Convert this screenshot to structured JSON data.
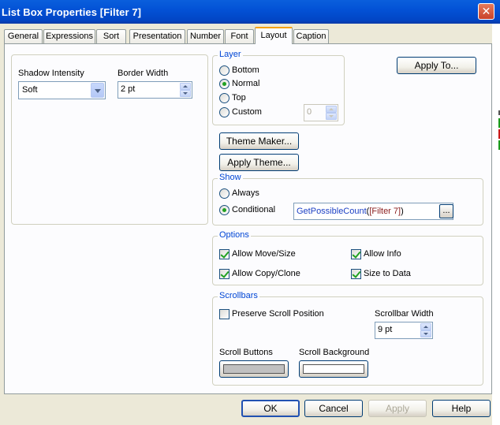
{
  "window": {
    "title": "List Box Properties [Filter 7]"
  },
  "tabs": [
    {
      "label": "General"
    },
    {
      "label": "Expressions"
    },
    {
      "label": "Sort"
    },
    {
      "label": "Presentation"
    },
    {
      "label": "Number"
    },
    {
      "label": "Font"
    },
    {
      "label": "Layout",
      "active": true
    },
    {
      "label": "Caption"
    }
  ],
  "shadow": {
    "label": "Shadow Intensity",
    "value": "Soft"
  },
  "border": {
    "label": "Border Width",
    "value": "2 pt"
  },
  "layer": {
    "legend": "Layer",
    "options": [
      {
        "label": "Bottom",
        "checked": false
      },
      {
        "label": "Normal",
        "checked": true
      },
      {
        "label": "Top",
        "checked": false
      },
      {
        "label": "Custom",
        "checked": false
      }
    ],
    "custom_value": "0"
  },
  "buttons": {
    "apply_to": "Apply To...",
    "theme_maker": "Theme Maker...",
    "apply_theme": "Apply Theme...",
    "ellipsis": "..."
  },
  "show": {
    "legend": "Show",
    "always": "Always",
    "conditional": "Conditional",
    "expression_fn": "GetPossibleCount",
    "expression_open": "(",
    "expression_field": "[Filter 7]",
    "expression_close": ")"
  },
  "options": {
    "legend": "Options",
    "allow_move_size": "Allow Move/Size",
    "allow_info": "Allow Info",
    "allow_copy_clone": "Allow Copy/Clone",
    "size_to_data": "Size to Data"
  },
  "scrollbars": {
    "legend": "Scrollbars",
    "preserve": "Preserve Scroll Position",
    "width_label": "Scrollbar Width",
    "width_value": "9 pt",
    "buttons_label": "Scroll Buttons",
    "buttons_color": "#c0c0c0",
    "background_label": "Scroll Background",
    "background_color": "#ffffff"
  },
  "footer": {
    "ok": "OK",
    "cancel": "Cancel",
    "apply": "Apply",
    "help": "Help"
  },
  "colors": {
    "title_bar": "#0352d6",
    "group_legend": "#0046d5",
    "check": "#21a121"
  }
}
